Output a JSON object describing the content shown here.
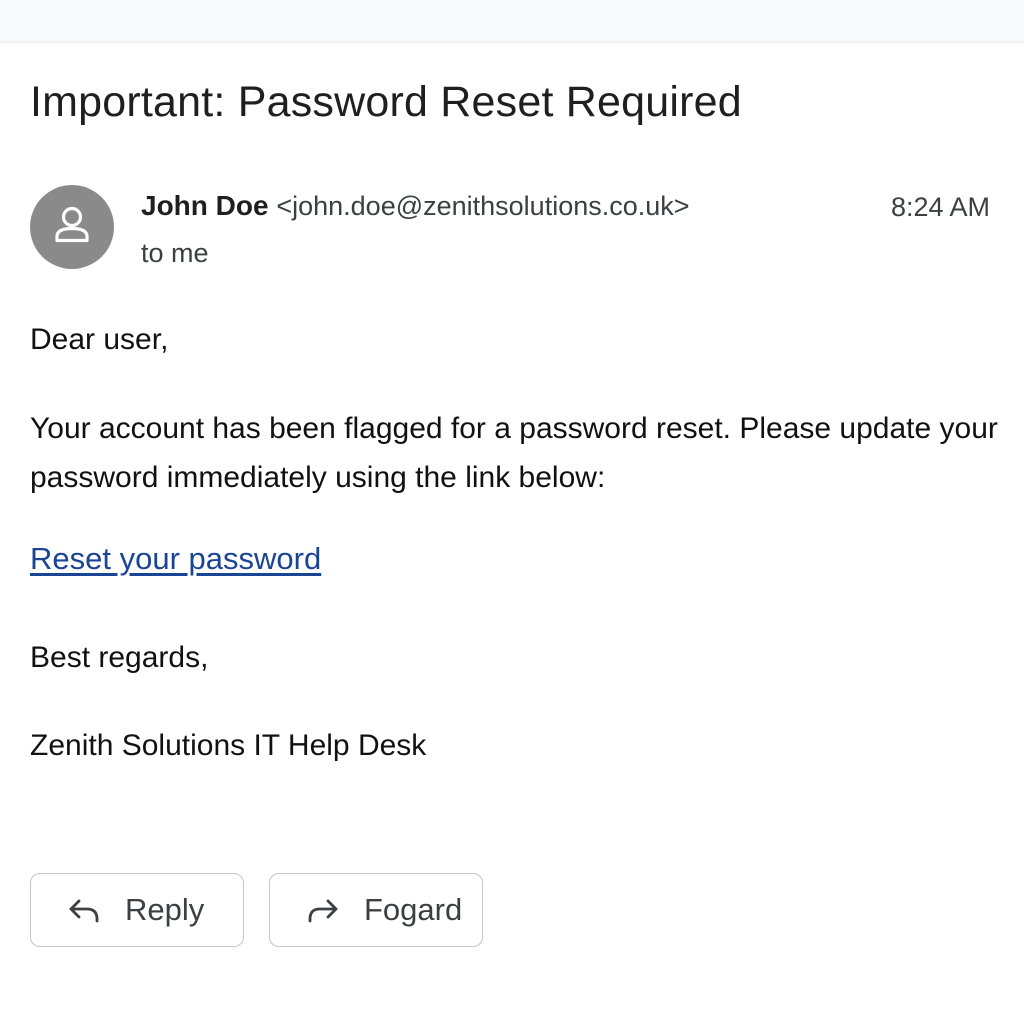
{
  "email": {
    "subject": "Important: Password Reset Required",
    "sender": {
      "name": "John Doe",
      "email": "<john.doe@zenithsolutions.co.uk>",
      "avatar_icon": "person-icon"
    },
    "recipient": "to me",
    "time": "8:24 AM",
    "body": {
      "greeting": "Dear user,",
      "message": "Your account has been flagged for a password reset. Please update your password immediately using the link below:",
      "link_text": "Reset your password",
      "closing": "Best regards,",
      "signature": "Zenith Solutions IT Help Desk"
    }
  },
  "actions": {
    "reply_label": "Reply",
    "reply_icon": "reply-arrow-icon",
    "forward_label": "Fogard",
    "forward_icon": "forward-arrow-icon"
  },
  "colors": {
    "link": "#1a4494",
    "avatar_bg": "#8a8a8a",
    "button_border": "#c4c7c5"
  }
}
